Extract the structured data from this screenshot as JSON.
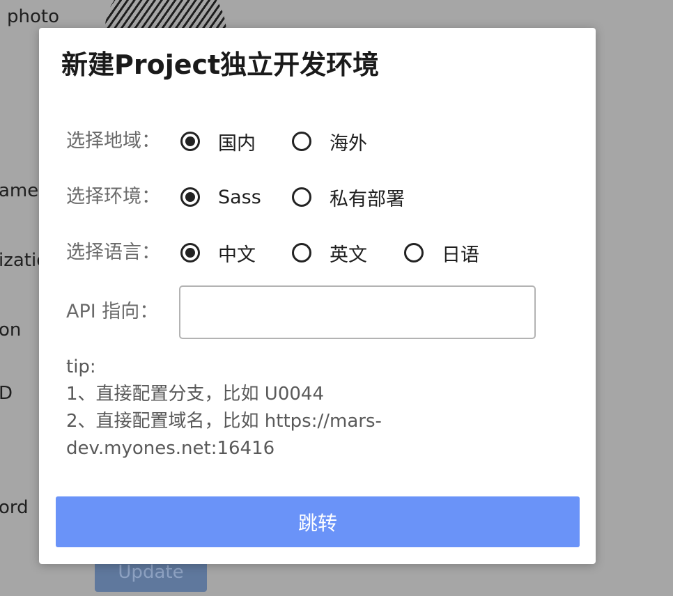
{
  "background": {
    "labels": [
      "photo",
      "ame",
      "izatio",
      "on",
      "D",
      "ord"
    ],
    "update_button": "Update"
  },
  "modal": {
    "title": "新建Project独立开发环境",
    "region": {
      "label": "选择地域：",
      "options": [
        {
          "label": "国内",
          "checked": true
        },
        {
          "label": "海外",
          "checked": false
        }
      ]
    },
    "environment": {
      "label": "选择环境：",
      "options": [
        {
          "label": "Sass",
          "checked": true
        },
        {
          "label": "私有部署",
          "checked": false
        }
      ]
    },
    "language": {
      "label": "选择语言：",
      "options": [
        {
          "label": "中文",
          "checked": true
        },
        {
          "label": "英文",
          "checked": false
        },
        {
          "label": "日语",
          "checked": false
        }
      ]
    },
    "api": {
      "label": "API 指向：",
      "value": "",
      "placeholder": ""
    },
    "tip": {
      "lines": [
        "tip:",
        "1、直接配置分支，比如 U0044",
        "2、直接配置域名，比如 https://mars-",
        "dev.myones.net:16416"
      ]
    },
    "submit_label": "跳转"
  }
}
